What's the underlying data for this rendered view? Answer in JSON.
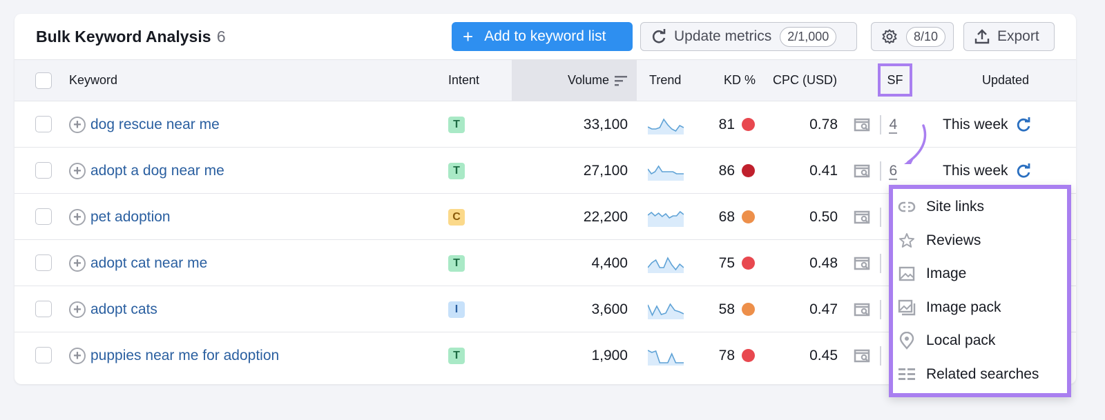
{
  "header": {
    "title": "Bulk Keyword Analysis",
    "count": "6",
    "add_button": "Add to keyword list",
    "update_button": "Update metrics",
    "update_count": "2/1,000",
    "settings_count": "8/10",
    "export_button": "Export"
  },
  "columns": {
    "keyword": "Keyword",
    "intent": "Intent",
    "volume": "Volume",
    "trend": "Trend",
    "kd": "KD %",
    "cpc": "CPC (USD)",
    "sf": "SF",
    "updated": "Updated"
  },
  "colors": {
    "accent": "#2e8ff0",
    "highlight": "#a97ff0",
    "link": "#2a5fa0",
    "kd_red": "#e8484f",
    "kd_darkred": "#c0202d",
    "kd_orange": "#ed8f4a",
    "intent_T_bg": "#a9e9c6",
    "intent_T_fg": "#1d6b43",
    "intent_C_bg": "#fbd98a",
    "intent_C_fg": "#8a5a0b",
    "intent_I_bg": "#c7e1fa",
    "intent_I_fg": "#2a5fa0"
  },
  "rows": [
    {
      "keyword": "dog rescue near me",
      "intent": "T",
      "volume": "33,100",
      "trend": [
        0.45,
        0.3,
        0.3,
        0.4,
        1.0,
        0.6,
        0.3,
        0.15,
        0.55,
        0.4
      ],
      "kd": "81",
      "kd_level": "red",
      "cpc": "0.78",
      "sf": "4",
      "updated": "This week"
    },
    {
      "keyword": "adopt a dog near me",
      "intent": "T",
      "volume": "27,100",
      "trend": [
        0.75,
        0.4,
        0.55,
        0.95,
        0.55,
        0.55,
        0.55,
        0.55,
        0.4,
        0.4,
        0.4
      ],
      "kd": "86",
      "kd_level": "darkred",
      "cpc": "0.41",
      "sf": "6",
      "updated": "This week"
    },
    {
      "keyword": "pet adoption",
      "intent": "C",
      "volume": "22,200",
      "trend": [
        0.75,
        0.95,
        0.7,
        0.9,
        0.65,
        0.85,
        0.55,
        0.7,
        0.7,
        1.0,
        0.8
      ],
      "kd": "68",
      "kd_level": "orange",
      "cpc": "0.50",
      "sf": "",
      "updated": ""
    },
    {
      "keyword": "adopt cat near me",
      "intent": "T",
      "volume": "4,400",
      "trend": [
        0.3,
        0.65,
        0.85,
        0.3,
        0.3,
        1.0,
        0.5,
        0.15,
        0.55,
        0.3
      ],
      "kd": "75",
      "kd_level": "red",
      "cpc": "0.48",
      "sf": "",
      "updated": ""
    },
    {
      "keyword": "adopt cats",
      "intent": "I",
      "volume": "3,600",
      "trend": [
        0.95,
        0.2,
        0.85,
        0.25,
        0.35,
        1.0,
        0.55,
        0.45,
        0.3
      ],
      "kd": "58",
      "kd_level": "orange",
      "cpc": "0.47",
      "sf": "",
      "updated": ""
    },
    {
      "keyword": "puppies near me for adoption",
      "intent": "T",
      "volume": "1,900",
      "trend": [
        1.0,
        0.85,
        0.95,
        0.1,
        0.1,
        0.1,
        0.75,
        0.1,
        0.1,
        0.1
      ],
      "kd": "78",
      "kd_level": "red",
      "cpc": "0.45",
      "sf": "",
      "updated": ""
    }
  ],
  "popup": {
    "items": [
      {
        "icon": "link-icon",
        "label": "Site links"
      },
      {
        "icon": "star-icon",
        "label": "Reviews"
      },
      {
        "icon": "image-icon",
        "label": "Image"
      },
      {
        "icon": "image-pack-icon",
        "label": "Image pack"
      },
      {
        "icon": "location-pin-icon",
        "label": "Local pack"
      },
      {
        "icon": "related-searches-icon",
        "label": "Related searches"
      }
    ]
  }
}
